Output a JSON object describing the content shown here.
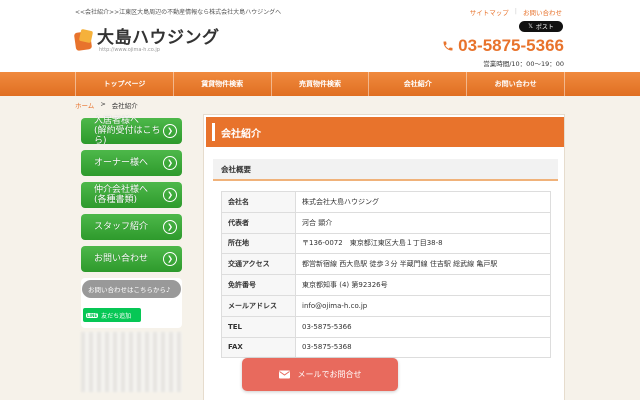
{
  "header": {
    "tagline": "<<会社紹介>>江東区大島周辺の不動産情報なら株式会社大島ハウジングへ",
    "util_links": [
      "サイトマップ",
      "お問い合わせ"
    ],
    "x_post": "ポスト",
    "logo_name": "大島ハウジング",
    "logo_url": "http://www.ojima-h.co.jp",
    "phone": "03-5875-5366",
    "hours": "営業時間/10：00～19：00"
  },
  "nav": [
    "トップページ",
    "賃貸物件検索",
    "売買物件検索",
    "会社紹介",
    "お問い合わせ"
  ],
  "breadcrumb": {
    "home": "ホーム",
    "sep": ">",
    "current": "会社紹介"
  },
  "sidebar": {
    "buttons": [
      "入居者様へ\n(解約受付はこちら)",
      "オーナー様へ",
      "仲介会社様へ\n(各種書類)",
      "スタッフ紹介",
      "お問い合わせ"
    ],
    "line_bubble": "お問い合わせはこちらから♪",
    "line_logo": "LINE",
    "line_add": "友だち追加"
  },
  "main": {
    "title": "会社紹介",
    "section": "会社概要",
    "rows": [
      {
        "label": "会社名",
        "value": "株式会社大島ハウジング"
      },
      {
        "label": "代表者",
        "value": "河合 顕介"
      },
      {
        "label": "所在地",
        "value": "〒136-0072　東京都江東区大島１丁目38-8"
      },
      {
        "label": "交通アクセス",
        "value": "都営新宿線 西大島駅 徒歩３分 半蔵門線 住吉駅 総武線 亀戸駅"
      },
      {
        "label": "免許番号",
        "value": "東京都知事 (4) 第92326号"
      },
      {
        "label": "メールアドレス",
        "value": "info@ojima-h.co.jp"
      },
      {
        "label": "TEL",
        "value": "03-5875-5366"
      },
      {
        "label": "FAX",
        "value": "03-5875-5368"
      }
    ]
  },
  "mail_cta": "メールでお問合せ",
  "colors": {
    "accent": "#e8732c",
    "green": "#3aa838",
    "line": "#06c755",
    "cta": "#e86a5d"
  }
}
